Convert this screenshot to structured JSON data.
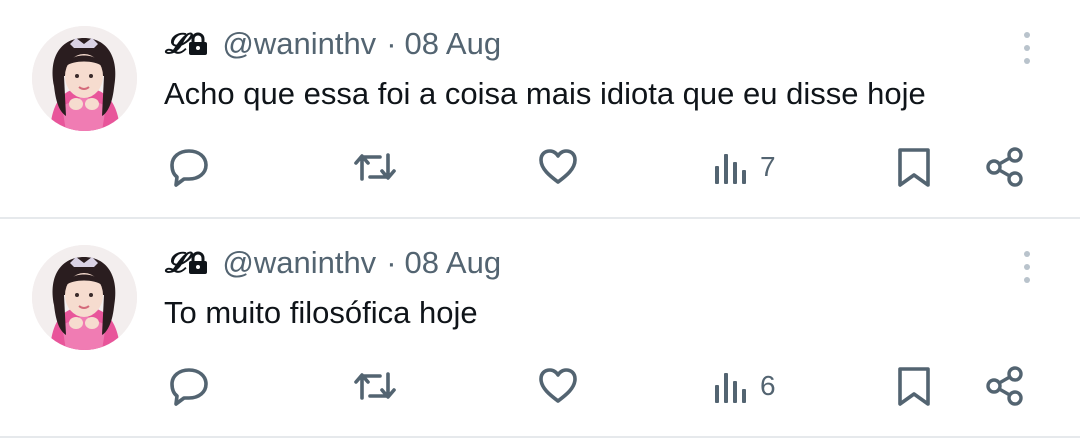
{
  "tweets": [
    {
      "display_name": "𝓛",
      "handle": "@waninthv",
      "separator": "·",
      "date": "08 Aug",
      "text": "Acho que essa foi a coisa mais idiota que eu disse hoje",
      "views": "7"
    },
    {
      "display_name": "𝓛",
      "handle": "@waninthv",
      "separator": "·",
      "date": "08 Aug",
      "text": "To muito filosófica hoje",
      "views": "6"
    }
  ],
  "icons": {
    "lock": "lock-icon",
    "more": "more-vertical-icon",
    "reply": "reply-icon",
    "retweet": "retweet-icon",
    "like": "heart-icon",
    "views": "views-icon",
    "bookmark": "bookmark-icon",
    "share": "share-icon"
  },
  "colors": {
    "text": "#0f1419",
    "secondary": "#536471",
    "divider": "#e6e9ec",
    "avatar_accent": "#e8559a"
  }
}
